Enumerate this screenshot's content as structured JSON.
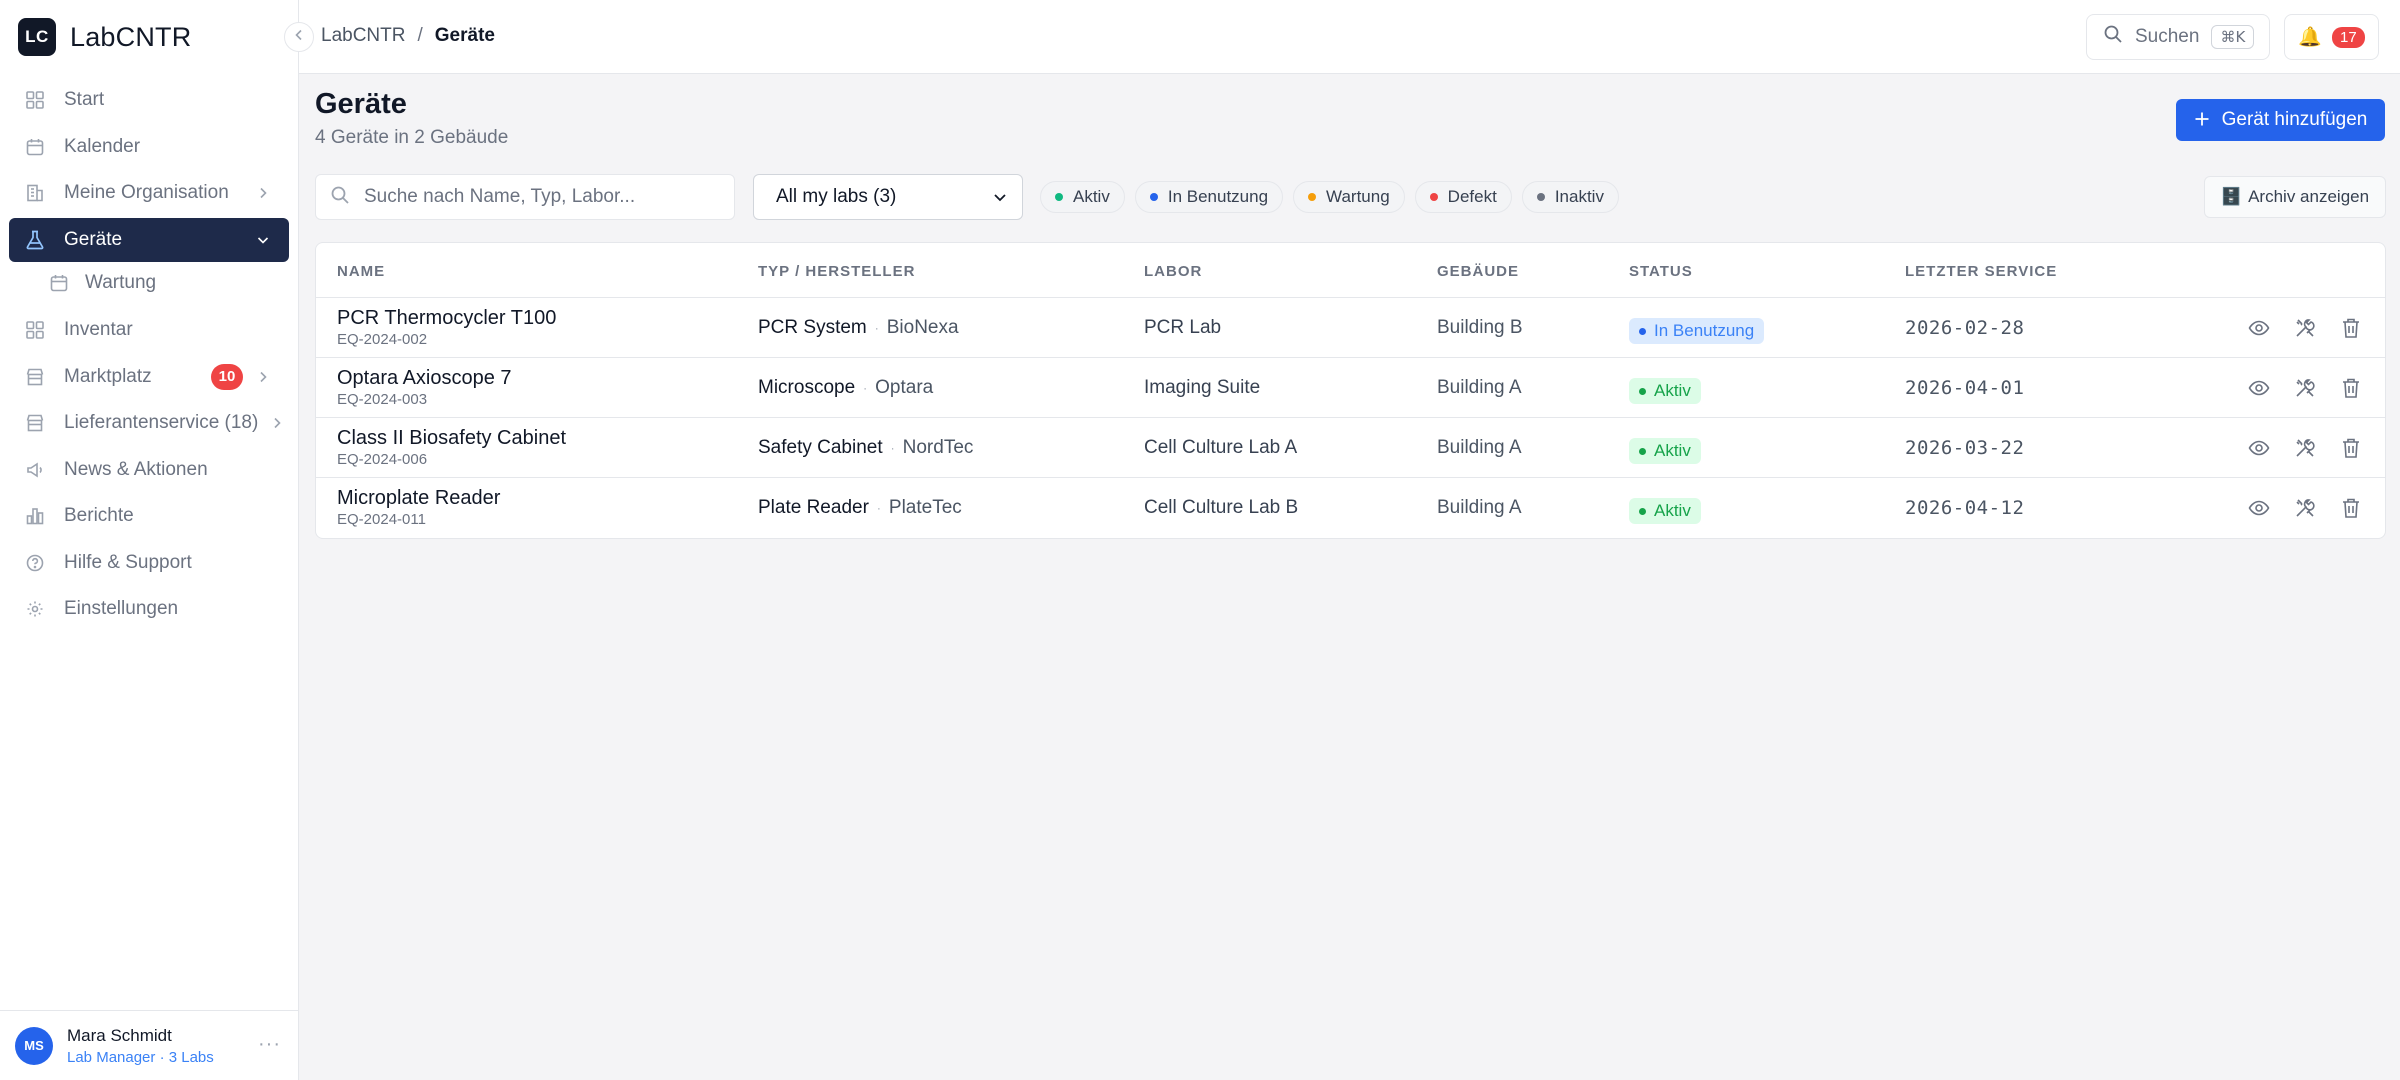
{
  "brand": {
    "logo_text": "LC",
    "name": "LabCNTR"
  },
  "sidebar": {
    "items": [
      {
        "label": "Start",
        "icon": "grid-icon"
      },
      {
        "label": "Kalender",
        "icon": "calendar-icon"
      },
      {
        "label": "Meine Organisation",
        "icon": "building-icon"
      },
      {
        "label": "Geräte",
        "icon": "flask-icon"
      },
      {
        "label": "Wartung",
        "icon": "calendar-icon"
      },
      {
        "label": "Inventar",
        "icon": "grid-icon"
      },
      {
        "label": "Marktplatz",
        "icon": "store-icon",
        "badge": "10"
      },
      {
        "label": "Lieferantenservice (18)",
        "icon": "store-icon"
      },
      {
        "label": "News & Aktionen",
        "icon": "megaphone-icon"
      },
      {
        "label": "Berichte",
        "icon": "bar-chart-icon"
      },
      {
        "label": "Hilfe & Support",
        "icon": "help-circle-icon"
      },
      {
        "label": "Einstellungen",
        "icon": "gear-icon"
      }
    ]
  },
  "user": {
    "initials": "MS",
    "name": "Mara Schmidt",
    "role": "Lab Manager · 3 Labs",
    "more": "···"
  },
  "breadcrumb": {
    "root": "LabCNTR",
    "sep": "/",
    "current": "Geräte"
  },
  "topbar": {
    "search_label": "Suchen",
    "shortcut": "⌘K",
    "notif_icon": "🔔",
    "notif_count": "17"
  },
  "page": {
    "title": "Geräte",
    "subtitle": "4 Geräte in 2 Gebäude",
    "add_label": "Gerät hinzufügen"
  },
  "filters": {
    "search_placeholder": "Suche nach Name, Typ, Labor...",
    "labs_value": "All my labs (3)",
    "chips": [
      {
        "label": "Aktiv",
        "color": "#10b981"
      },
      {
        "label": "In Benutzung",
        "color": "#2563eb"
      },
      {
        "label": "Wartung",
        "color": "#f59e0b"
      },
      {
        "label": "Defekt",
        "color": "#ef4444"
      },
      {
        "label": "Inaktiv",
        "color": "#6b7280"
      }
    ],
    "archive_icon": "🗄️",
    "archive_label": "Archiv anzeigen"
  },
  "table": {
    "columns": [
      "NAME",
      "TYP / HERSTELLER",
      "LABOR",
      "GEBÄUDE",
      "STATUS",
      "LETZTER SERVICE"
    ],
    "rows": [
      {
        "name": "PCR Thermocycler T100",
        "id": "EQ-2024-002",
        "type": "PCR System",
        "sep": "·",
        "maker": "BioNexa",
        "lab": "PCR Lab",
        "building": "Building B",
        "status": "In Benutzung",
        "service": "2026-02-28"
      },
      {
        "name": "Optara Axioscope 7",
        "id": "EQ-2024-003",
        "type": "Microscope",
        "sep": "·",
        "maker": "Optara",
        "lab": "Imaging Suite",
        "building": "Building A",
        "status": "Aktiv",
        "service": "2026-04-01"
      },
      {
        "name": "Class II Biosafety Cabinet",
        "id": "EQ-2024-006",
        "type": "Safety Cabinet",
        "sep": "·",
        "maker": "NordTec",
        "lab": "Cell Culture Lab A",
        "building": "Building A",
        "status": "Aktiv",
        "service": "2026-03-22"
      },
      {
        "name": "Microplate Reader",
        "id": "EQ-2024-011",
        "type": "Plate Reader",
        "sep": "·",
        "maker": "PlateTec",
        "lab": "Cell Culture Lab B",
        "building": "Building A",
        "status": "Aktiv",
        "service": "2026-04-12"
      }
    ]
  }
}
